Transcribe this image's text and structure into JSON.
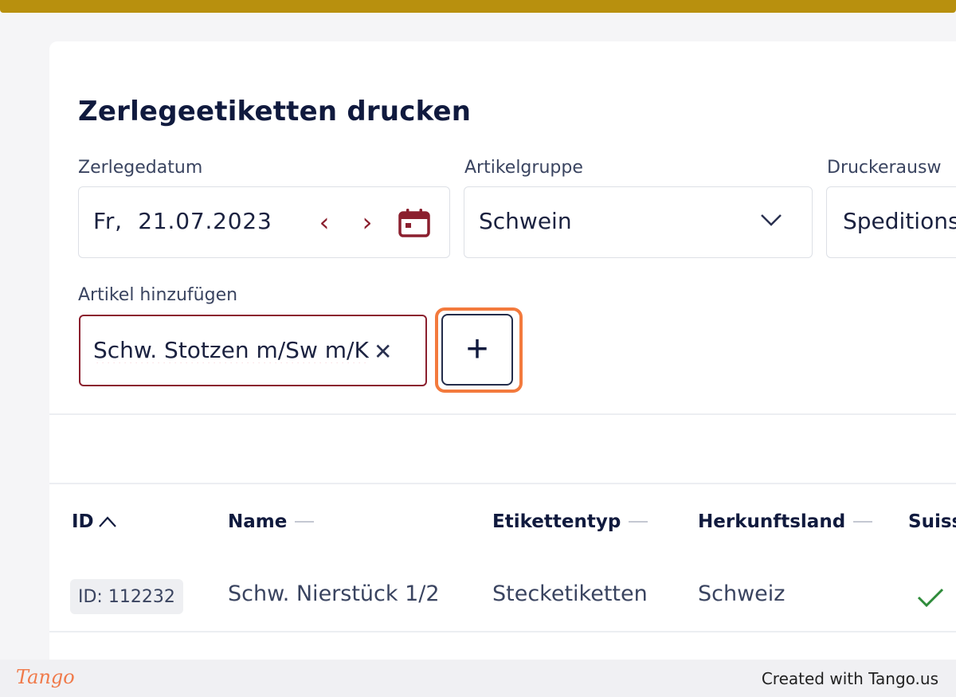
{
  "page": {
    "title": "Zerlegeetiketten drucken"
  },
  "form": {
    "date": {
      "label": "Zerlegedatum",
      "day": "Fr,",
      "value": "21.07.2023",
      "prev_icon": "chevron-left-icon",
      "next_icon": "chevron-right-icon",
      "calendar_icon": "calendar-icon"
    },
    "group": {
      "label": "Artikelgruppe",
      "value": "Schwein",
      "icon": "chevron-down-icon"
    },
    "printer": {
      "label": "Druckerausw",
      "value": "Speditions"
    },
    "article": {
      "label": "Artikel hinzufügen",
      "value": "Schw. Stotzen m/Sw m/K",
      "clear_icon": "close-icon"
    },
    "add_button": {
      "label": "+",
      "icon": "plus-icon"
    }
  },
  "table": {
    "headers": [
      "ID",
      "Name",
      "Etikettentyp",
      "Herkunftsland",
      "Suiss"
    ],
    "rows": [
      {
        "id": "ID: 112232",
        "name": "Schw. Nierstück 1/2",
        "type": "Stecketiketten",
        "country": "Schweiz",
        "suisse_icon": "check-icon"
      }
    ]
  },
  "colors": {
    "accent": "#8b1f2e",
    "top_bar": "#b8900e",
    "highlight": "#f37a3d",
    "check": "#2e8b3a"
  },
  "footer": {
    "logo": "Tango",
    "credit": "Created with Tango.us"
  }
}
